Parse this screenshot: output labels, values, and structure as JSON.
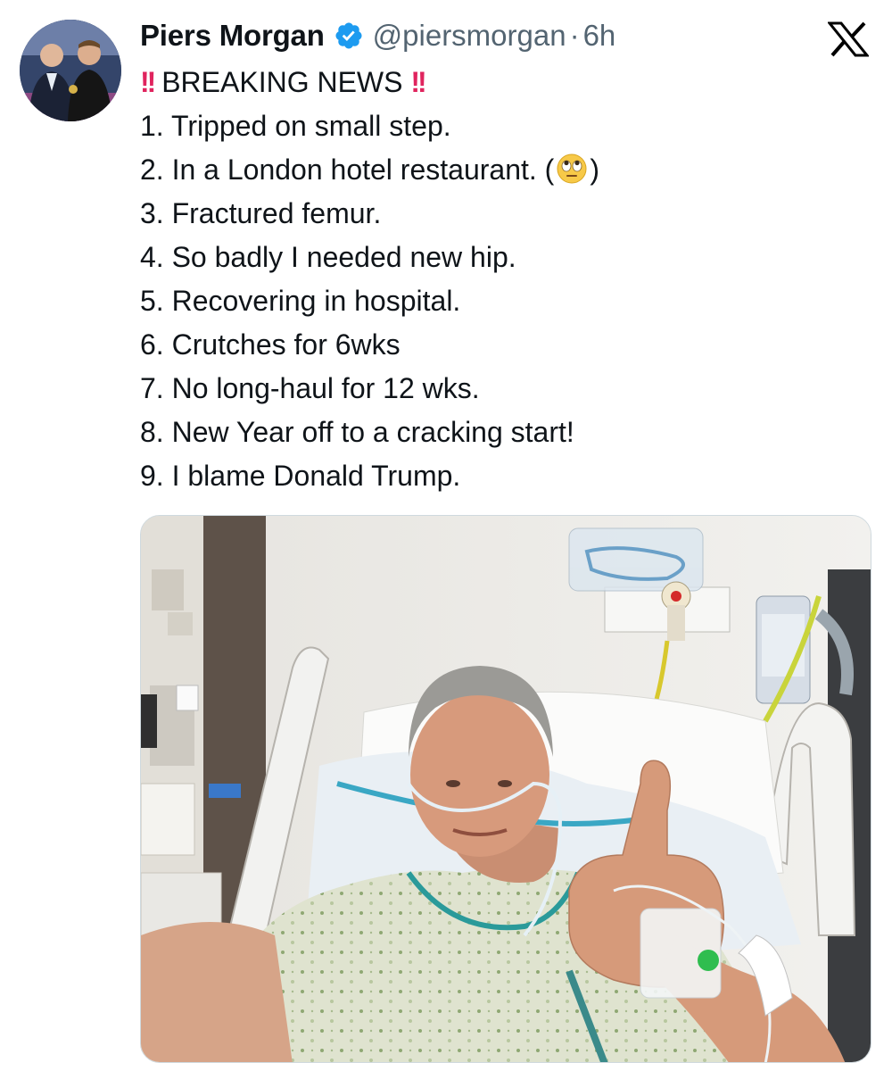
{
  "author": {
    "display_name": "Piers Morgan",
    "handle": "@piersmorgan",
    "separator": "·",
    "time": "6h",
    "verified_icon": "verified-badge-icon",
    "verified_color": "#1d9bf0"
  },
  "tweet": {
    "lines": [
      {
        "prefix": "‼️",
        "text": "BREAKING NEWS",
        "suffix": "‼️"
      },
      {
        "text": "1. Tripped on small step."
      },
      {
        "text": "2. In a London hotel restaurant. (",
        "emoji": "face-with-rolling-eyes",
        "after": ")"
      },
      {
        "text": "3. Fractured femur."
      },
      {
        "text": "4. So badly I needed new hip."
      },
      {
        "text": "5. Recovering in hospital."
      },
      {
        "text": "6. Crutches for 6wks"
      },
      {
        "text": "7. No long-haul for 12 wks."
      },
      {
        "text": "8. New Year off to a cracking start!"
      },
      {
        "text": "9. I blame Donald Trump."
      }
    ],
    "bang_glyph": "!!"
  },
  "media": {
    "type": "photo",
    "subject": "hospital-selfie-thumbs-up"
  },
  "brand": {
    "logo_icon": "x-logo-icon",
    "logo_color": "#000000"
  }
}
